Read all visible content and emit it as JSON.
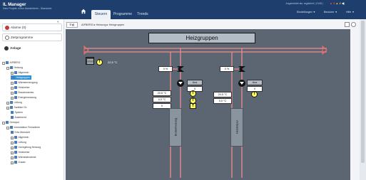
{
  "app": {
    "title": "IL Manager",
    "subtitle": "Dies Projekt: Arbor Musterheim - Standorte"
  },
  "header": {
    "tabs": [
      {
        "label": "Steuern",
        "active": true
      },
      {
        "label": "Programme",
        "active": false
      },
      {
        "label": "Trends",
        "active": false
      }
    ],
    "user_line": "Angemeldet als: registriert | 13:05 |",
    "alarm_a": "▲ 3",
    "alarm_w": "▲ 2",
    "menu_settings": "Einstellungen ▼",
    "menu_user": "Benutzer ▼",
    "menu_help": "Hilfe ▼"
  },
  "sidebar": {
    "alarms_label": "Alarme (0)",
    "programs_label": "Zeitprogramme",
    "plants_label": "Anlage",
    "tree": [
      {
        "label": "AIFBERG",
        "level": 0,
        "toggle": "-"
      },
      {
        "label": "Heizung",
        "level": 1,
        "toggle": "-"
      },
      {
        "label": "Allgemein",
        "level": 2,
        "toggle": "+"
      },
      {
        "label": "Heizgruppen",
        "level": 2,
        "toggle": "",
        "selected": true
      },
      {
        "label": "Wärmeerzeugung",
        "level": 2,
        "toggle": "+"
      },
      {
        "label": "Heizkreise",
        "level": 2,
        "toggle": "+"
      },
      {
        "label": "Brauchwarmw.",
        "level": 2,
        "toggle": "+"
      },
      {
        "label": "Energiemessung",
        "level": 2,
        "toggle": "+"
      },
      {
        "label": "Lüftung",
        "level": 1,
        "toggle": "+"
      },
      {
        "label": "Sanitäre Ch.",
        "level": 1,
        "toggle": "+"
      },
      {
        "label": "System",
        "level": 2,
        "toggle": ""
      },
      {
        "label": "Anstehend",
        "level": 2,
        "toggle": ""
      },
      {
        "label": "Demopol",
        "level": 0,
        "toggle": "-"
      },
      {
        "label": "Innenstation Fernwärme",
        "level": 1,
        "toggle": "-"
      },
      {
        "label": "Erfa Übersicht",
        "level": 2,
        "toggle": ""
      },
      {
        "label": "Allgemein",
        "level": 2,
        "toggle": "+"
      },
      {
        "label": "Lüftung",
        "level": 2,
        "toggle": "+"
      },
      {
        "label": "Vorregelung Heizung",
        "level": 2,
        "toggle": "+"
      },
      {
        "label": "Heizkreise",
        "level": 2,
        "toggle": "+"
      },
      {
        "label": "Wärmeabnahme",
        "level": 2,
        "toggle": "+"
      },
      {
        "label": "Zusatz",
        "level": 2,
        "toggle": "+"
      }
    ]
  },
  "breadcrumb": {
    "button": "☰ ◧",
    "path": "AIFBERG ▸ Heizung ▸ Heizgruppen"
  },
  "schematic": {
    "title": "Heizgruppen",
    "outside_temp": "22,5 °C",
    "group1": {
      "name": "Bodenheizung",
      "valve_pos": "0 %",
      "pump_state": "Aus",
      "pump_value": "0",
      "supply_temp": "20,5 °C",
      "return_temp": "0,0 °C",
      "setpoint": "0"
    },
    "group2": {
      "name": "Heizkörper",
      "valve_pos": "0 %",
      "pump_state": "Aus",
      "pump_value": "0",
      "supply_temp": "20,5 °C",
      "return_temp": "0,0 °C"
    },
    "temp_symbol": "T"
  },
  "colors": {
    "header": "#1e3f6e",
    "canvas": "#5b6672",
    "pipe": "#f08c8c",
    "sensor": "#ffff60",
    "selected": "#2f8fd0"
  }
}
